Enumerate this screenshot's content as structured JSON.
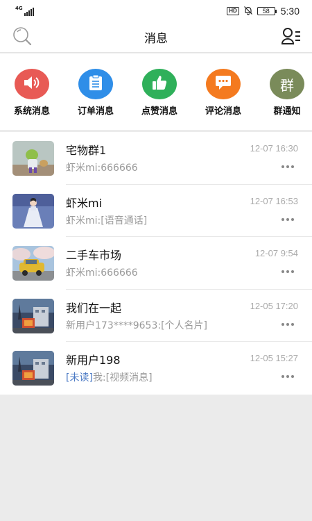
{
  "status_bar": {
    "network": "4G",
    "time": "5:30",
    "hd_badge": "HD",
    "battery": "58"
  },
  "header": {
    "title": "消息"
  },
  "categories": [
    {
      "label": "系统消息",
      "color": "#e85a55",
      "icon": "speaker-icon"
    },
    {
      "label": "订单消息",
      "color": "#2f8ee8",
      "icon": "clipboard-icon"
    },
    {
      "label": "点赞消息",
      "color": "#2fb05a",
      "icon": "thumbs-up-icon"
    },
    {
      "label": "评论消息",
      "color": "#f47a1f",
      "icon": "chat-bubble-icon"
    },
    {
      "label": "群通知",
      "color": "#7a8b5a",
      "icon": "group-icon",
      "glyph": "群"
    }
  ],
  "conversations": [
    {
      "name": "宅物群1",
      "time": "12-07 16:30",
      "preview": "虾米mi:666666",
      "unread_tag": ""
    },
    {
      "name": "虾米mi",
      "time": "12-07 16:53",
      "preview": "虾米mi:[语音通话]",
      "unread_tag": ""
    },
    {
      "name": "二手车市场",
      "time": "12-07 9:54",
      "preview": "虾米mi:666666",
      "unread_tag": ""
    },
    {
      "name": "我们在一起",
      "time": "12-05 17:20",
      "preview": "新用户173****9653:[个人名片]",
      "unread_tag": ""
    },
    {
      "name": "新用户198",
      "time": "12-05 15:27",
      "preview": "我:[视频消息]",
      "unread_tag": "[未读]"
    }
  ],
  "colors": {
    "accent_unread": "#4a79c4",
    "background": "#ebebeb"
  }
}
